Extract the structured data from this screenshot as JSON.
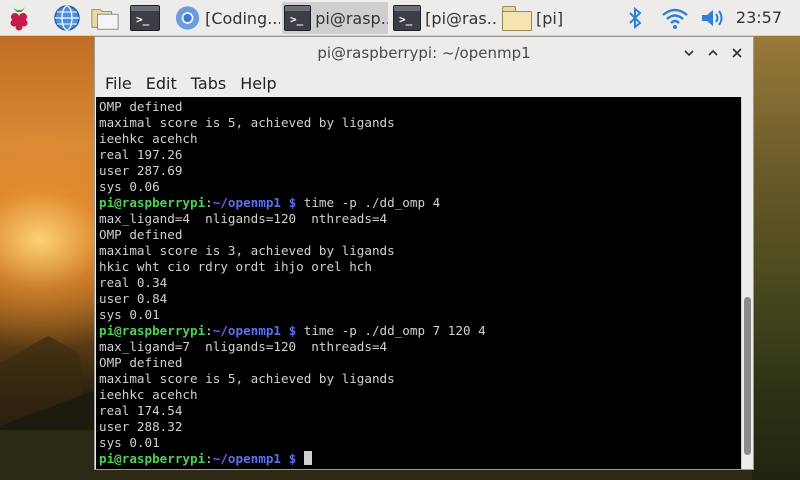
{
  "taskbar": {
    "tasks": [
      {
        "label": "[Coding..."
      },
      {
        "label": "pi@rasp..."
      },
      {
        "label": "[pi@ras..."
      },
      {
        "label": "[pi]"
      }
    ],
    "clock": "23:57",
    "terminal_glyph": ">_"
  },
  "window": {
    "title": "pi@raspberrypi: ~/openmp1",
    "menu": [
      "File",
      "Edit",
      "Tabs",
      "Help"
    ]
  },
  "terminal": {
    "prompt_user": "pi@raspberrypi",
    "prompt_sep": ":",
    "prompt_path": "~/openmp1 $",
    "lines": [
      {
        "type": "out",
        "text": "OMP defined"
      },
      {
        "type": "out",
        "text": "maximal score is 5, achieved by ligands"
      },
      {
        "type": "out",
        "text": "ieehkc acehch"
      },
      {
        "type": "out",
        "text": "real 197.26"
      },
      {
        "type": "out",
        "text": "user 287.69"
      },
      {
        "type": "out",
        "text": "sys 0.06"
      },
      {
        "type": "cmd",
        "text": " time -p ./dd_omp 4"
      },
      {
        "type": "out",
        "text": "max_ligand=4  nligands=120  nthreads=4"
      },
      {
        "type": "out",
        "text": "OMP defined"
      },
      {
        "type": "out",
        "text": "maximal score is 3, achieved by ligands"
      },
      {
        "type": "out",
        "text": "hkic wht cio rdry ordt ihjo orel hch"
      },
      {
        "type": "out",
        "text": "real 0.34"
      },
      {
        "type": "out",
        "text": "user 0.84"
      },
      {
        "type": "out",
        "text": "sys 0.01"
      },
      {
        "type": "cmd",
        "text": " time -p ./dd_omp 7 120 4"
      },
      {
        "type": "out",
        "text": "max_ligand=7  nligands=120  nthreads=4"
      },
      {
        "type": "out",
        "text": "OMP defined"
      },
      {
        "type": "out",
        "text": "maximal score is 5, achieved by ligands"
      },
      {
        "type": "out",
        "text": "ieehkc acehch"
      },
      {
        "type": "out",
        "text": "real 174.54"
      },
      {
        "type": "out",
        "text": "user 288.32"
      },
      {
        "type": "out",
        "text": "sys 0.01"
      },
      {
        "type": "prompt",
        "text": " "
      }
    ]
  },
  "icons": {
    "launcher": [
      "raspberry-menu-icon",
      "web-browser-icon",
      "file-manager-icon",
      "terminal-icon"
    ],
    "tray": [
      "bluetooth-icon",
      "wifi-icon",
      "volume-icon"
    ]
  },
  "colors": {
    "prompt_user": "#4fd04f",
    "prompt_path": "#5b6ff0",
    "terminal_bg": "#000000",
    "terminal_fg": "#d0d0d0",
    "tray_blue": "#2f7fd9"
  }
}
